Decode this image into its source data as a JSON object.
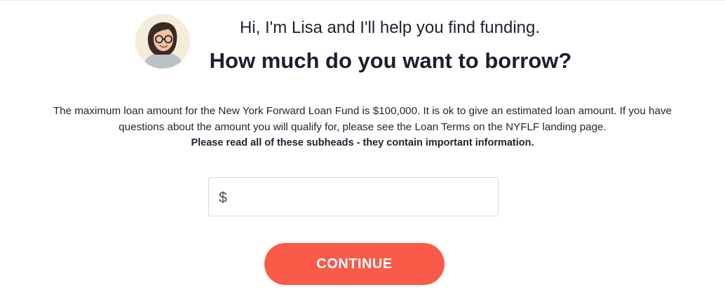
{
  "header": {
    "greeting": "Hi, I'm Lisa and I'll help you find funding.",
    "question": "How much do you want to borrow?"
  },
  "subhead": {
    "line1": "The maximum loan amount for the New York Forward Loan Fund is $100,000. It is ok to give an estimated loan amount. If you have",
    "line2": "questions about the amount you will qualify for, please see the Loan Terms on the NYFLF landing page.",
    "emphasis": "Please read all of these subheads - they contain important information."
  },
  "amount_field": {
    "currency_symbol": "$",
    "value": "",
    "placeholder": ""
  },
  "actions": {
    "continue_label": "CONTINUE"
  },
  "colors": {
    "accent": "#fa5a48",
    "text": "#1f2330",
    "border": "#d7d9dd"
  },
  "icons": {
    "avatar": "advisor-avatar-photo"
  }
}
